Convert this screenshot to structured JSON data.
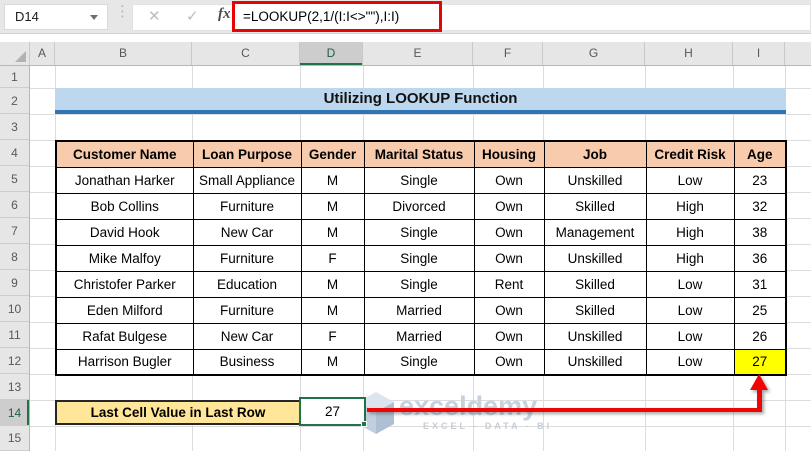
{
  "formula_bar": {
    "name_box": "D14",
    "dropdown_icon": "caret-down",
    "separator_icon": "⋮",
    "cancel_icon": "✕",
    "enter_icon": "✓",
    "fx_icon": "fx",
    "formula": "=LOOKUP(2,1/(I:I<>\"\"),I:I)"
  },
  "sheet": {
    "column_letters": [
      "A",
      "B",
      "C",
      "D",
      "E",
      "F",
      "G",
      "H",
      "I"
    ],
    "selected_column": "D",
    "row_numbers": [
      "1",
      "2",
      "3",
      "4",
      "5",
      "6",
      "7",
      "8",
      "9",
      "10",
      "11",
      "12",
      "13",
      "14",
      "15"
    ],
    "selected_row": "14"
  },
  "title": "Utilizing LOOKUP Function",
  "table": {
    "headers": [
      "Customer Name",
      "Loan Purpose",
      "Gender",
      "Marital Status",
      "Housing",
      "Job",
      "Credit Risk",
      "Age"
    ],
    "rows": [
      [
        "Jonathan Harker",
        "Small Appliance",
        "M",
        "Single",
        "Own",
        "Unskilled",
        "Low",
        "23"
      ],
      [
        "Bob Collins",
        "Furniture",
        "M",
        "Divorced",
        "Own",
        "Skilled",
        "High",
        "32"
      ],
      [
        "David Hook",
        "New Car",
        "M",
        "Single",
        "Own",
        "Management",
        "High",
        "38"
      ],
      [
        "Mike Malfoy",
        "Furniture",
        "F",
        "Single",
        "Own",
        "Unskilled",
        "High",
        "36"
      ],
      [
        "Christofer Parker",
        "Education",
        "M",
        "Single",
        "Rent",
        "Skilled",
        "Low",
        "31"
      ],
      [
        "Eden Milford",
        "Furniture",
        "M",
        "Married",
        "Own",
        "Skilled",
        "Low",
        "25"
      ],
      [
        "Rafat Bulgese",
        "New Car",
        "F",
        "Married",
        "Own",
        "Unskilled",
        "Low",
        "26"
      ],
      [
        "Harrison Bugler",
        "Business",
        "M",
        "Single",
        "Own",
        "Unskilled",
        "Low",
        "27"
      ]
    ],
    "highlight": {
      "row_index": 7,
      "col_index": 7,
      "value": "27"
    }
  },
  "result": {
    "label": "Last Cell Value in Last Row",
    "value": "27"
  },
  "watermark": {
    "brand": "exceldemy",
    "tagline": "EXCEL - DATA - BI"
  },
  "colors": {
    "title_fill": "#BDD7EE",
    "title_rule": "#2E75B6",
    "table_header_fill": "#F8CBAD",
    "result_label_fill": "#FFE699",
    "highlight_fill": "#FFFF00",
    "selection_green": "#217346",
    "callout_red": "#F00505",
    "formula_box_red": "#E60505"
  }
}
